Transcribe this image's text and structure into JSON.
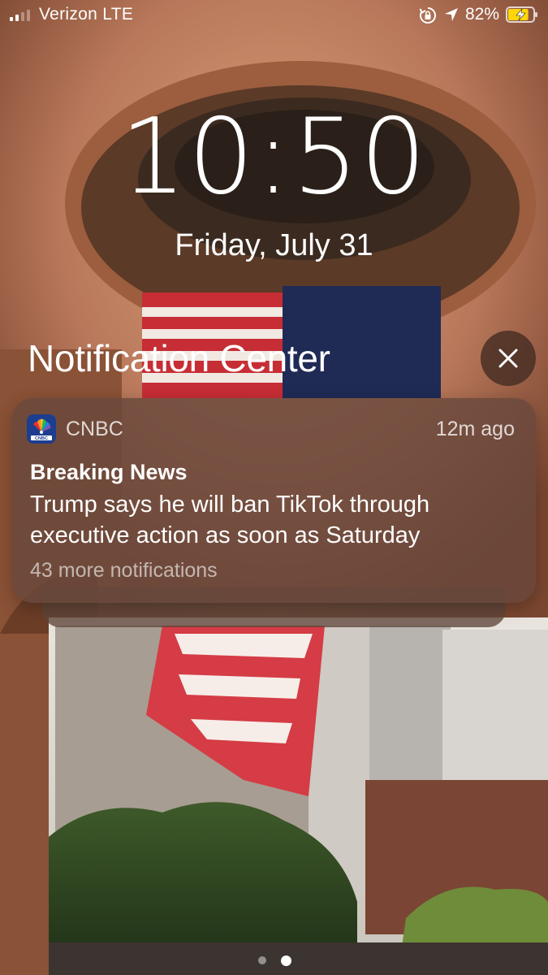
{
  "status_bar": {
    "carrier": "Verizon LTE",
    "battery_percent": "82%",
    "signal_bars_active": 2,
    "signal_bars_total": 4,
    "battery_level": 0.82,
    "battery_charging": true,
    "icons": [
      "orientation-lock-icon",
      "location-arrow-icon",
      "battery-charging-icon"
    ]
  },
  "lock_screen": {
    "time": "10:50",
    "date": "Friday, July 31"
  },
  "notification_center": {
    "title": "Notification Center",
    "close_icon": "close-icon"
  },
  "notification": {
    "app_name": "CNBC",
    "time_ago": "12m ago",
    "title": "Breaking News",
    "body": "Trump says he will ban TikTok through executive action as soon as Saturday",
    "more_label": "43 more notifications",
    "app_icon": "cnbc-peacock-icon"
  },
  "page_indicator": {
    "pages": 2,
    "active_index": 1
  },
  "colors": {
    "card_background": "#69483c",
    "text": "#ffffff",
    "battery_fill": "#ffd60a"
  }
}
